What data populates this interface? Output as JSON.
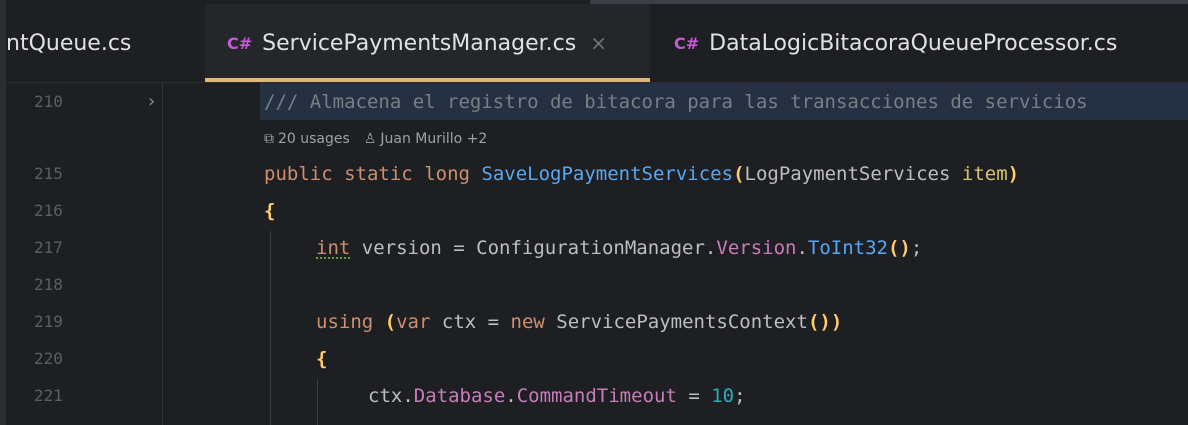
{
  "tabs": [
    {
      "label": "ntQueue.cs",
      "active": false
    },
    {
      "prefix": "C#",
      "label": "ServicePaymentsManager.cs",
      "close": "×",
      "active": true
    },
    {
      "prefix": "C#",
      "label": "DataLogicBitacoraQueueProcessor.cs",
      "active": false
    }
  ],
  "editor": {
    "lines": [
      {
        "n": "210",
        "text": "/// Almacena el registro de bitacora para las transacciones de servicios"
      },
      {
        "n": "215"
      },
      {
        "n": "216"
      },
      {
        "n": "217"
      },
      {
        "n": "218"
      },
      {
        "n": "219"
      },
      {
        "n": "220"
      },
      {
        "n": "221"
      }
    ],
    "hint": {
      "usages": "20 usages",
      "authors": "Juan Murillo +2"
    },
    "code": {
      "l215": {
        "kw1": "public",
        "kw2": "static",
        "kw3": "long",
        "fn": "SaveLogPaymentServices",
        "open": "(",
        "type": "LogPaymentServices",
        "param": "item",
        "close": ")"
      },
      "l216": "{",
      "l217": {
        "kw": "int",
        "rest": " version = ConfigurationManager.",
        "prop": "Version",
        "dot": ".",
        "fn": "ToInt32",
        "paren": "()",
        "semi": ";"
      },
      "l219": {
        "kw": "using",
        "open": "(",
        "kw2": "var",
        "mid": " ctx = ",
        "kw3": "new",
        "type": " ServicePaymentsContext",
        "paren": "()",
        "close": ")"
      },
      "l220": "{",
      "l221": {
        "pre": "ctx.",
        "p1": "Database",
        "dot": ".",
        "p2": "CommandTimeout",
        "eq": " = ",
        "num": "10",
        "semi": ";"
      }
    }
  },
  "colors": {
    "accent": "#dcb67a",
    "keyword": "#cf8e6d",
    "function": "#56a8f5",
    "property": "#c77dbb",
    "number": "#2aacb8"
  }
}
